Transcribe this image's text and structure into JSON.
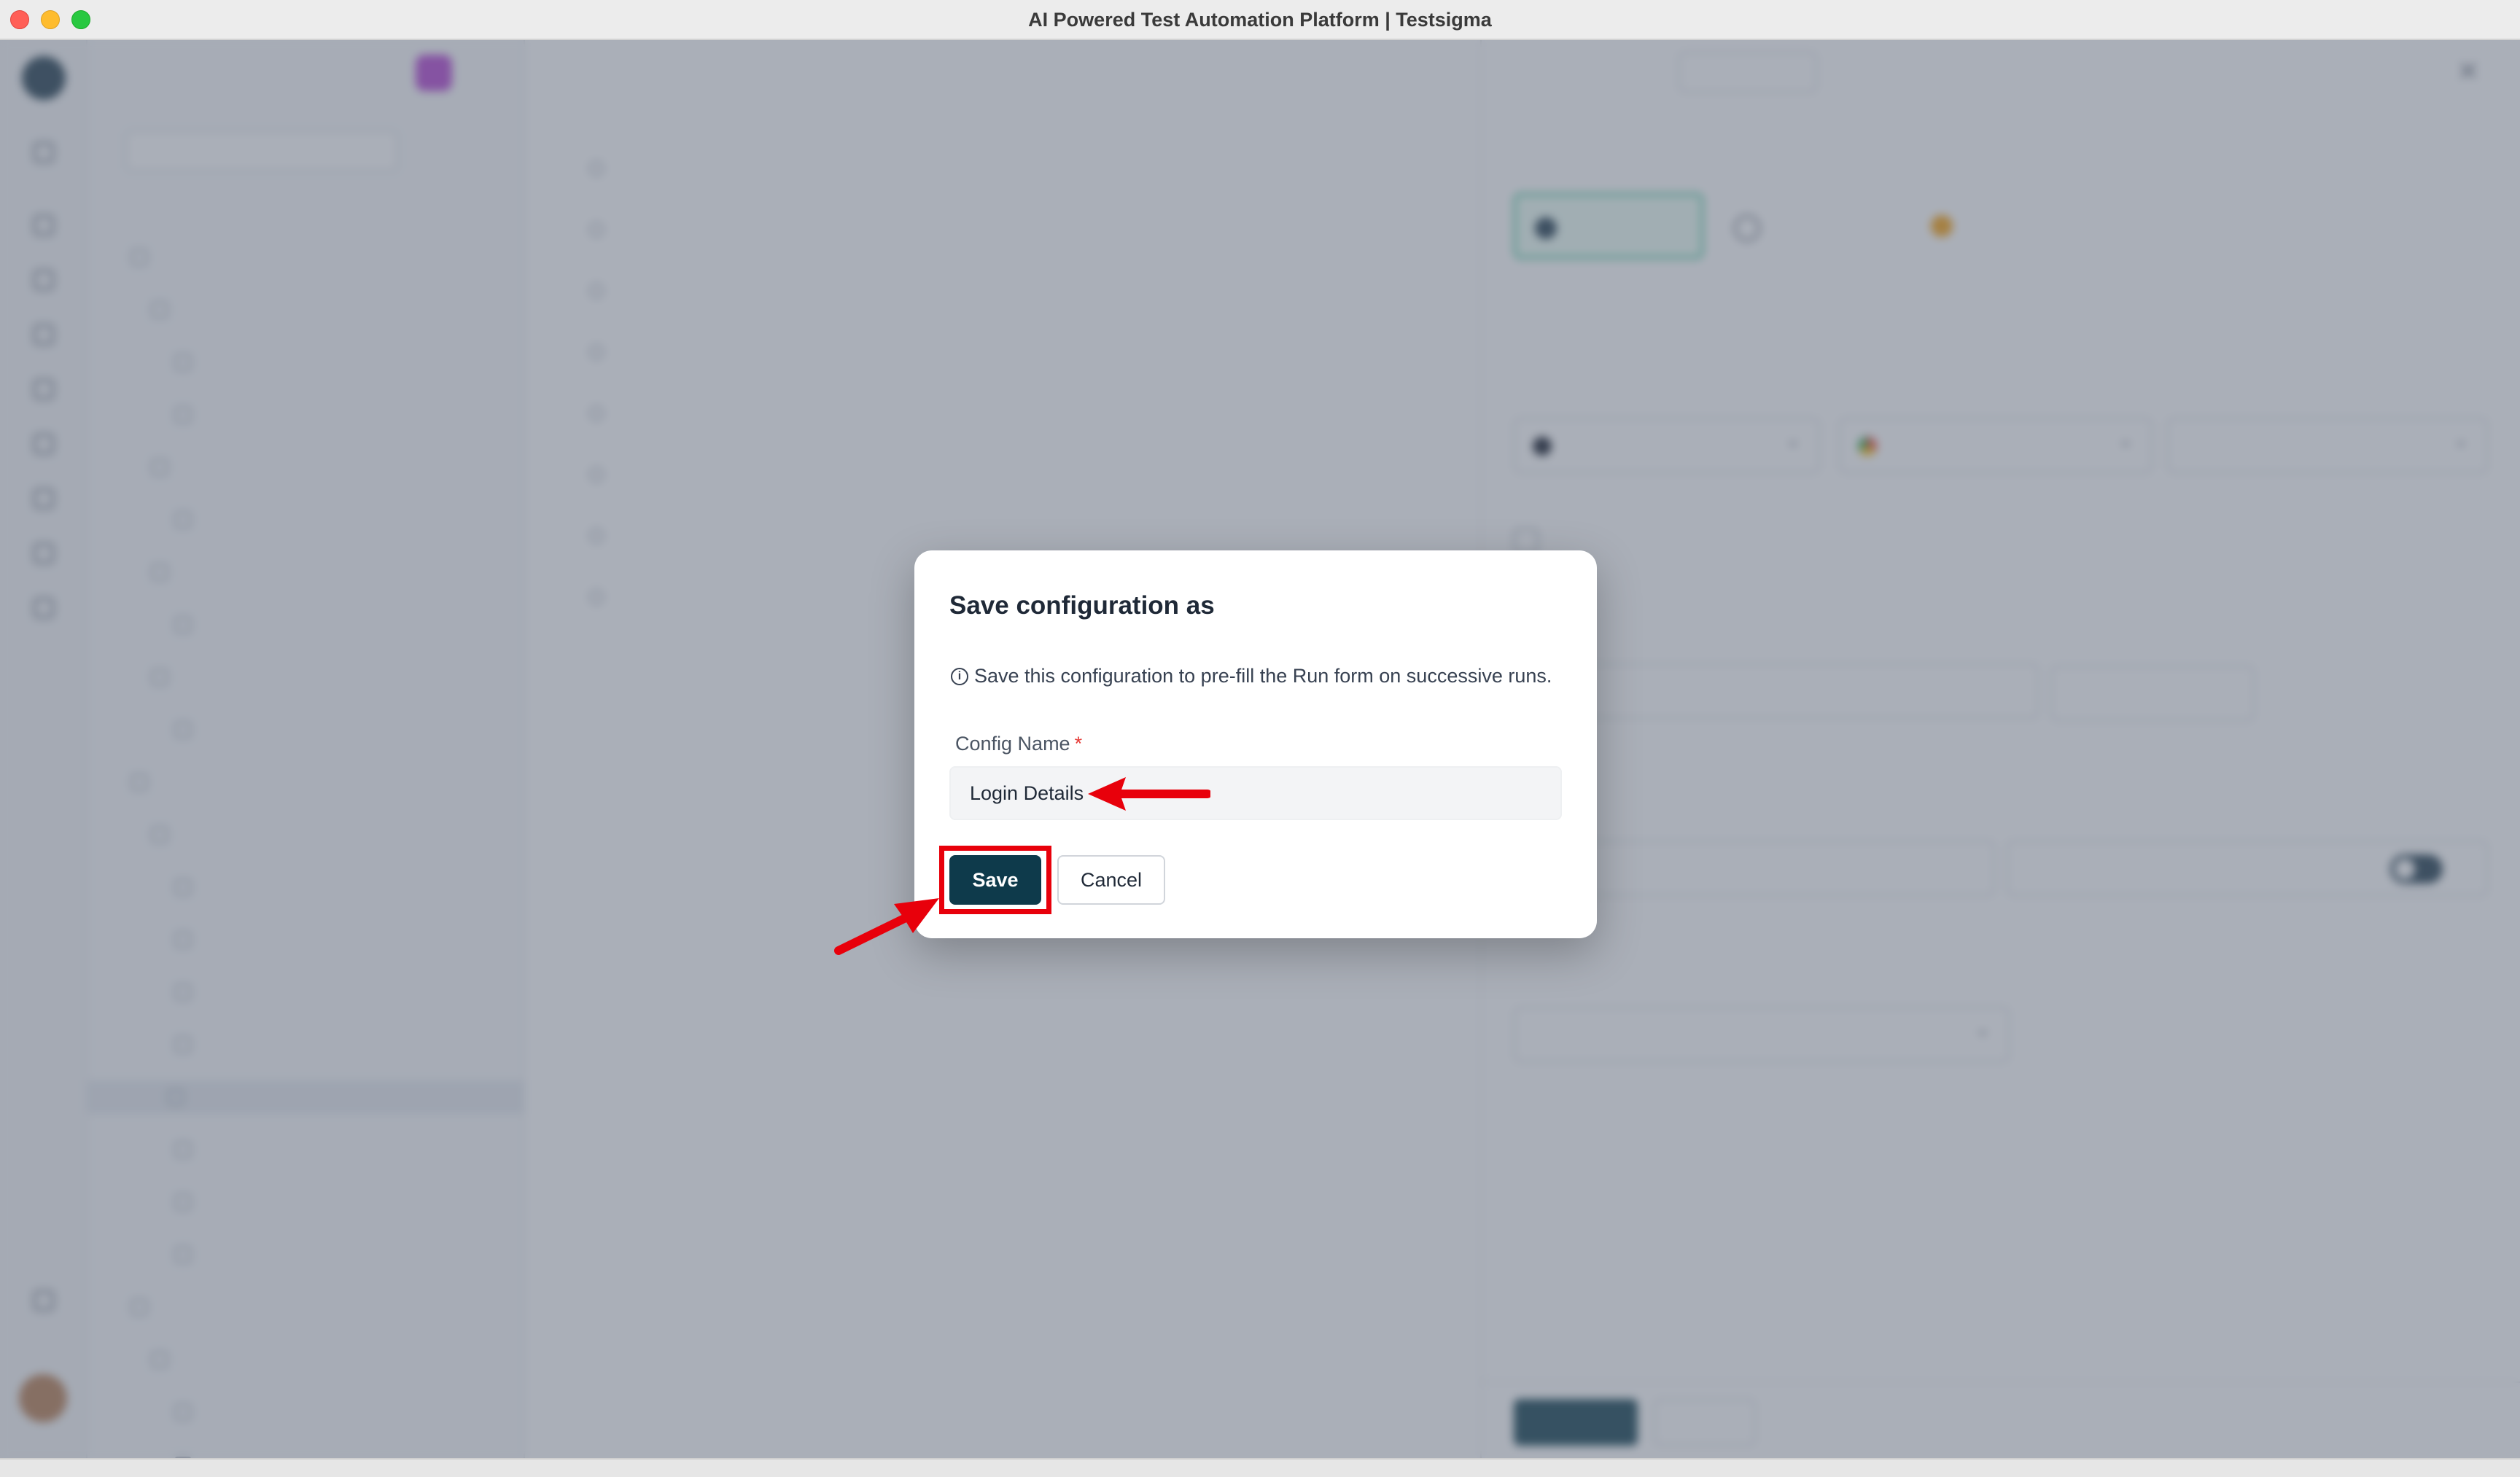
{
  "window": {
    "title": "AI Powered Test Automation Platform | Testsigma"
  },
  "modal": {
    "title": "Save configuration as",
    "info": "Save this configuration to pre-fill the Run form on successive runs.",
    "field_label": "Config Name",
    "required_mark": "*",
    "config_name_value": "Login Details",
    "save_label": "Save",
    "cancel_label": "Cancel"
  },
  "colors": {
    "primary": "#0e3a4b",
    "annotation": "#e8000b",
    "required": "#e53935"
  },
  "icons": {
    "info": "info-circle-icon",
    "arrow": "red-arrow-annotation"
  }
}
